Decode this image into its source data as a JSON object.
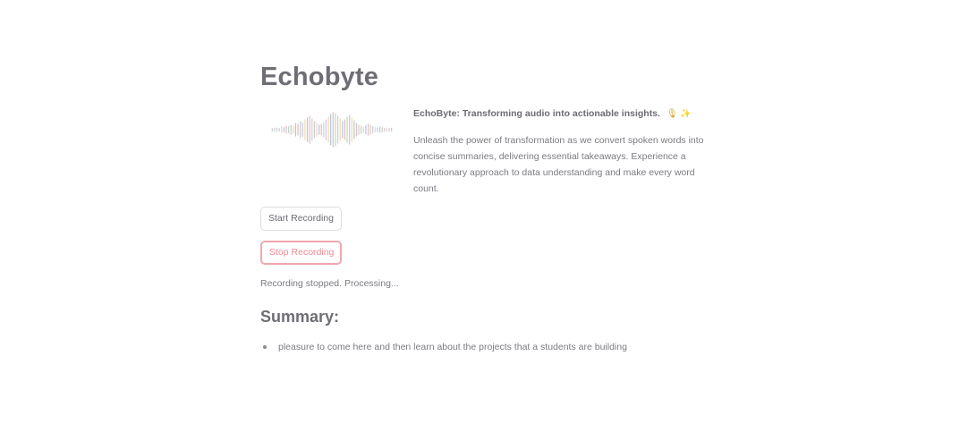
{
  "app": {
    "title": "Echobyte"
  },
  "intro": {
    "tagline": "EchoByte: Transforming audio into actionable insights.",
    "tagline_emojis": "🎙 ✨",
    "description": "Unleash the power of transformation as we convert spoken words into concise summaries, delivering essential takeaways. Experience a revolutionary approach to data understanding and make every word count.",
    "waveform_icon": "audio-waveform-icon"
  },
  "controls": {
    "start_label": "Start Recording",
    "stop_label": "Stop Recording"
  },
  "status": {
    "text": "Recording stopped. Processing..."
  },
  "summary": {
    "heading": "Summary:",
    "items": [
      "pleasure to come here and then learn about the projects that a students are building"
    ]
  },
  "colors": {
    "accent": "#ef8a92",
    "waveform": [
      "#a8c8e8",
      "#f2b8b8",
      "#b8dcc4",
      "#d8c0e8",
      "#f0d8a8"
    ]
  }
}
